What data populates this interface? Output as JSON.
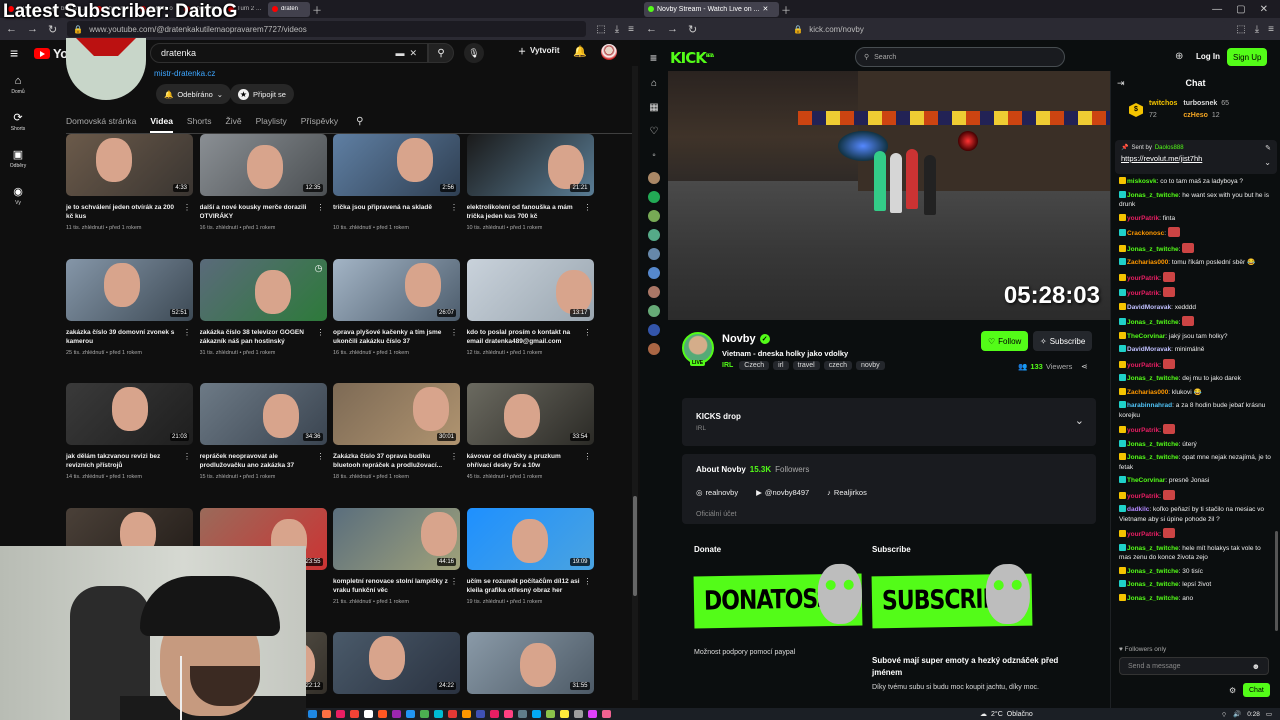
{
  "overlay": {
    "title": "Latest Subscriber: DaitoG"
  },
  "left_browser": {
    "tabs": [
      {
        "label": "EJ.zi",
        "color": "#ff0000"
      },
      {
        "label": "bird are re",
        "color": "#888888"
      },
      {
        "label": "The Truth",
        "color": "#ff0000"
      },
      {
        "label": "15KMs o",
        "color": "#ff0000"
      },
      {
        "label": "They WA",
        "color": "#ff0000"
      },
      {
        "label": "Turn 2 Eg",
        "color": "#ff0000"
      },
      {
        "label": "dratén",
        "color": "#ff0000"
      }
    ],
    "url": "www.youtube.com/@dratenkakutilemaopravarem7727/videos"
  },
  "youtube": {
    "logo_text": "YouTube",
    "logo_region": "CZ",
    "search_value": "dratenka",
    "create_label": "Vytvořit",
    "side_nav": [
      {
        "icon": "⌂",
        "label": "Domů",
        "name": "home-icon"
      },
      {
        "icon": "⟳",
        "label": "Shorts",
        "name": "shorts-icon"
      },
      {
        "icon": "▣",
        "label": "Odběry",
        "name": "subscriptions-icon"
      },
      {
        "icon": "◉",
        "label": "Vy",
        "name": "you-icon"
      }
    ],
    "channel_link": "mistr-dratenka.cz",
    "subscribed_label": "Odebíráno",
    "join_label": "Připojit se",
    "tabs": [
      "Domovská stránka",
      "Videa",
      "Shorts",
      "Živě",
      "Playlisty",
      "Příspěvky"
    ],
    "active_tab": "Videa",
    "videos": [
      {
        "title": "je to schválení jeden otvírák za 200 kč kus",
        "meta": "11 tis. zhlédnutí • před 1 rokem",
        "duration": "4:33"
      },
      {
        "title": "další a nové kousky merče dorazili OTVIRÁKY",
        "meta": "16 tis. zhlédnutí • před 1 rokem",
        "duration": "12:35"
      },
      {
        "title": "trička jsou připravená na skladě",
        "meta": "10 tis. zhlédnutí • před 1 rokem",
        "duration": "2:56"
      },
      {
        "title": "elektrolikolení od fanouška a mám trička jeden kus 700 kč",
        "meta": "10 tis. zhlédnutí • před 1 rokem",
        "duration": "21:21"
      },
      {
        "title": "zakázka číslo 39 domovní zvonek s kamerou",
        "meta": "25 tis. zhlédnutí • před 1 rokem",
        "duration": "52:51"
      },
      {
        "title": "zakázka číslo 38 televizor GOGEN zákazník náš pan hostinský",
        "meta": "31 tis. zhlédnutí • před 1 rokem",
        "duration": ""
      },
      {
        "title": "oprava plyšové kačenky a tím jsme ukončili zakázku číslo 37",
        "meta": "16 tis. zhlédnutí • před 1 rokem",
        "duration": "26:07"
      },
      {
        "title": "kdo to poslal prosím o kontakt na email dratenka489@gmail.com",
        "meta": "12 tis. zhlédnutí • před 1 rokem",
        "duration": "13:17"
      },
      {
        "title": "jak dělám takzvanou revizi bez revizních přístrojů",
        "meta": "14 tis. zhlédnutí • před 1 rokem",
        "duration": "21:03"
      },
      {
        "title": "repráček neopravovat ale prodlužovačku ano zakázka 37",
        "meta": "15 tis. zhlédnutí • před 1 rokem",
        "duration": "34:36"
      },
      {
        "title": "Zakázka číslo 37 oprava budíku bluetooh repráček a prodlužovací...",
        "meta": "18 tis. zhlédnutí • před 1 rokem",
        "duration": "30:01"
      },
      {
        "title": "kávovar od dívačky a pruzkum ohřívací desky 5v a 10w",
        "meta": "45 tis. zhlédnutí • před 1 rokem",
        "duration": "33:54"
      },
      {
        "title": "",
        "meta": "",
        "duration": ""
      },
      {
        "title": "",
        "meta": "",
        "duration": "23:55"
      },
      {
        "title": "kompletní renovace stolní lampičky z vraku funkční věc",
        "meta": "21 tis. zhlédnutí • před 1 rokem",
        "duration": "44:16"
      },
      {
        "title": "učím se rozumět počítačům díl12 asi kleila grafika otřesný obraz her",
        "meta": "19 tis. zhlédnutí • před 1 rokem",
        "duration": "19:09"
      },
      {
        "title": "",
        "meta": "",
        "duration": ""
      },
      {
        "title": "",
        "meta": "",
        "duration": "22:12"
      },
      {
        "title": "",
        "meta": "",
        "duration": "24:22"
      },
      {
        "title": "",
        "meta": "",
        "duration": "31:55"
      }
    ]
  },
  "right_browser": {
    "tab_title": "Novby Stream - Watch Live on ...",
    "url": "kick.com/novby"
  },
  "kick": {
    "logo": "KICK",
    "logo_sup": "BETA",
    "search_placeholder": "Search",
    "login": "Log In",
    "signup": "Sign Up",
    "timer": "05:28:03",
    "streamer": "Novby",
    "live_badge": "LIVE",
    "stream_title": "Vietnam - dneska holky jako vdolky",
    "category": "IRL",
    "tags": [
      "Czech",
      "irl",
      "travel",
      "czech",
      "novby"
    ],
    "follow": "Follow",
    "subscribe": "Subscribe",
    "viewer_count": "133",
    "viewers_label": "Viewers",
    "kicks_drop_title": "KICKS drop",
    "kicks_drop_sub": "IRL",
    "about_prefix": "About Novby",
    "followers_count": "15.3K",
    "followers_label": "Followers",
    "socials": [
      {
        "icon": "◎",
        "label": "realnovby",
        "name": "instagram-icon"
      },
      {
        "icon": "▶",
        "label": "@novby8497",
        "name": "youtube-icon"
      },
      {
        "icon": "♪",
        "label": "Realjirkos",
        "name": "tiktok-icon"
      }
    ],
    "official_account": "Oficiální účet",
    "donate_title": "Donate",
    "donate_banner": "DONATOSS",
    "donate_desc": "Možnost podpory pomocí paypal",
    "subscribe_title": "Subscribe",
    "subscribe_banner": "SUBSCRIBE",
    "sub_desc_title": "Subové mají super emoty a hezký odznáček před jménem",
    "sub_desc": "Díky tvému subu si budu moc koupit jachtu, díky moc.",
    "accent": "#53fc18"
  },
  "chat": {
    "title": "Chat",
    "gifters": [
      {
        "name": "twitchos",
        "count": "72"
      },
      {
        "name": "turbosnek",
        "count": "65"
      },
      {
        "name": "czHeso",
        "count": "12"
      }
    ],
    "pinned_prefix": "Sent by",
    "pinned_user": "Daolos888",
    "pinned_link": "https://revolut.me/jist7hh",
    "messages": [
      {
        "user": "miskosvk",
        "color": "#53fc18",
        "text": ": co to tam maš za ladyboya ?"
      },
      {
        "user": "Jonas_z_twitche",
        "color": "#53fc18",
        "text": ": he want sex with you but he is drunk"
      },
      {
        "user": "yourPatrik",
        "color": "#e91e63",
        "text": ": finta"
      },
      {
        "user": "Crackonosc",
        "color": "#ff9800",
        "text": ":"
      },
      {
        "user": "Jonas_z_twitche",
        "color": "#53fc18",
        "text": ":"
      },
      {
        "user": "Zacharias000",
        "color": "#ff9800",
        "text": ": tomu říkám poslední sběr 😂"
      },
      {
        "user": "yourPatrik",
        "color": "#e91e63",
        "text": ":"
      },
      {
        "user": "yourPatrik",
        "color": "#e91e63",
        "text": ":"
      },
      {
        "user": "DavidMoravak",
        "color": "#c0c0ff",
        "text": ": xedddd"
      },
      {
        "user": "Jonas_z_twitche",
        "color": "#53fc18",
        "text": ":"
      },
      {
        "user": "TheCorvinar",
        "color": "#53fc18",
        "text": ": jaký jsou tam holky?"
      },
      {
        "user": "DavidMoravak",
        "color": "#c0c0ff",
        "text": ": minimálně"
      },
      {
        "user": "yourPatrik",
        "color": "#e91e63",
        "text": ":"
      },
      {
        "user": "Jonas_z_twitche",
        "color": "#53fc18",
        "text": ": dej mu to jako darek"
      },
      {
        "user": "Zacharias000",
        "color": "#ff9800",
        "text": ": klukovi 😂"
      },
      {
        "user": "harabinnahrad",
        "color": "#4fc3f7",
        "text": ": a za 8 hodin bude jebať krásnu korejku"
      },
      {
        "user": "yourPatrik",
        "color": "#e91e63",
        "text": ":"
      },
      {
        "user": "Jonas_z_twitche",
        "color": "#53fc18",
        "text": ": úterý"
      },
      {
        "user": "Jonas_z_twitche",
        "color": "#53fc18",
        "text": ": opat mne nejak nezajímá, je to fetak"
      },
      {
        "user": "TheCorvinar",
        "color": "#53fc18",
        "text": ": presně Jonasi"
      },
      {
        "user": "yourPatrik",
        "color": "#e91e63",
        "text": ":"
      },
      {
        "user": "dadkilc",
        "color": "#b388ff",
        "text": ": koľko peňazí by ti stačilo na mesiac vo Vietname aby si úpine pohode žil ?"
      },
      {
        "user": "yourPatrik",
        "color": "#e91e63",
        "text": ":"
      },
      {
        "user": "Jonas_z_twitche",
        "color": "#53fc18",
        "text": ": hele mít holakys tak vole to mas zenu do konce života zejo"
      },
      {
        "user": "Jonas_z_twitche",
        "color": "#53fc18",
        "text": ": 30 tisíc"
      },
      {
        "user": "Jonas_z_twitche",
        "color": "#53fc18",
        "text": ": lepsí život"
      },
      {
        "user": "Jonas_z_twitche",
        "color": "#53fc18",
        "text": ": ano"
      }
    ],
    "followers_only": "Followers only",
    "input_placeholder": "Send a message",
    "send_label": "Chat"
  },
  "taskbar": {
    "temperature": "2°C",
    "weather": "Oblačno",
    "time": "0:28"
  }
}
